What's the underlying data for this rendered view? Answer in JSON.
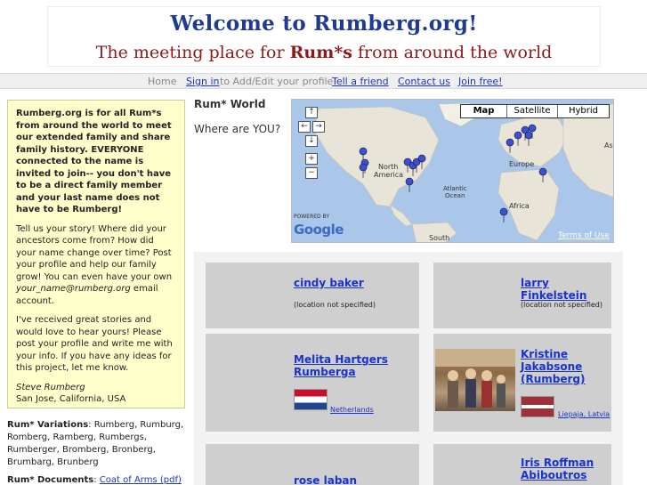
{
  "banner": {
    "line1": "Welcome to Rumberg.org!",
    "line2_pre": "The meeting place for ",
    "line2_bold": "Rum*s",
    "line2_post": " from around the world"
  },
  "nav": {
    "home": "Home",
    "signin": "Sign in",
    "signin_suffix": "to Add/Edit your profile!",
    "tell": "Tell a friend",
    "contact": "Contact us",
    "join": "Join free!"
  },
  "intro": {
    "bold_para": "Rumberg.org is for all Rum*s from around the world to meet our extended family and share family history. EVERYONE connected to the name is invited to join-- you don't have to be a direct family member and your last name does not have to be Rumberg!",
    "para2_pre": "Tell us your story! Where did your ancestors come from? How did your name change over time? Post your profile and help our family grow! You can even have your own ",
    "para2_email": "your_name@rumberg.org",
    "para2_post": " email account.",
    "para3": "I've received great stories and would love to hear yours! Please post your profile and write me with your info. If you have any ideas for this project, let me know.",
    "sig_name": "Steve Rumberg",
    "sig_loc": "San Jose, California, USA"
  },
  "variations": {
    "label": "Rum* Variations",
    "text": ": Rumberg, Rumburg, Romberg, Ramberg, Rumbergs, Rumberger, Bromberg, Bronberg, Brumbarg, Brunberg"
  },
  "documents": {
    "label": "Rum* Documents",
    "link": "Coat of Arms (pdf)"
  },
  "world": {
    "title": "Rum* World",
    "question": "Where are YOU?"
  },
  "map": {
    "types": [
      "Map",
      "Satellite",
      "Hybrid"
    ],
    "active_type": "Map",
    "labels": {
      "north_america": "North",
      "north_america2": "America",
      "europe": "Europe",
      "africa": "Africa",
      "atlantic1": "Atlantic",
      "atlantic2": "Ocean",
      "south_america": "South",
      "asia": "As"
    },
    "powered": "POWERED BY",
    "google": "Google",
    "terms": "Terms of Use",
    "controls": {
      "up": "↑",
      "left": "←",
      "right": "→",
      "center": "◎",
      "down": "↓",
      "zoom_in": "+",
      "zoom_out": "−"
    }
  },
  "profiles": [
    {
      "name": "cindy baker",
      "location": "(location not specified)"
    },
    {
      "name": "larry Finkelstein",
      "location": "(location not specified)"
    },
    {
      "name": "Melita Hartgers Rumberga",
      "location": "Netherlands"
    },
    {
      "name": "Kristine Jakabsone (Rumberg)",
      "location": "Liepaja, Latvia"
    },
    {
      "name": "rose laban",
      "location": ""
    },
    {
      "name": "Iris Roffman Abiboutros",
      "location": ""
    }
  ],
  "colors": {
    "link": "#1a33cc",
    "intro_bg": "#ffffcc",
    "banner_title": "#1f3a93",
    "banner_sub": "#8b1a1a",
    "map_water": "#aac6e8",
    "card_bg": "#cfcfcf"
  }
}
